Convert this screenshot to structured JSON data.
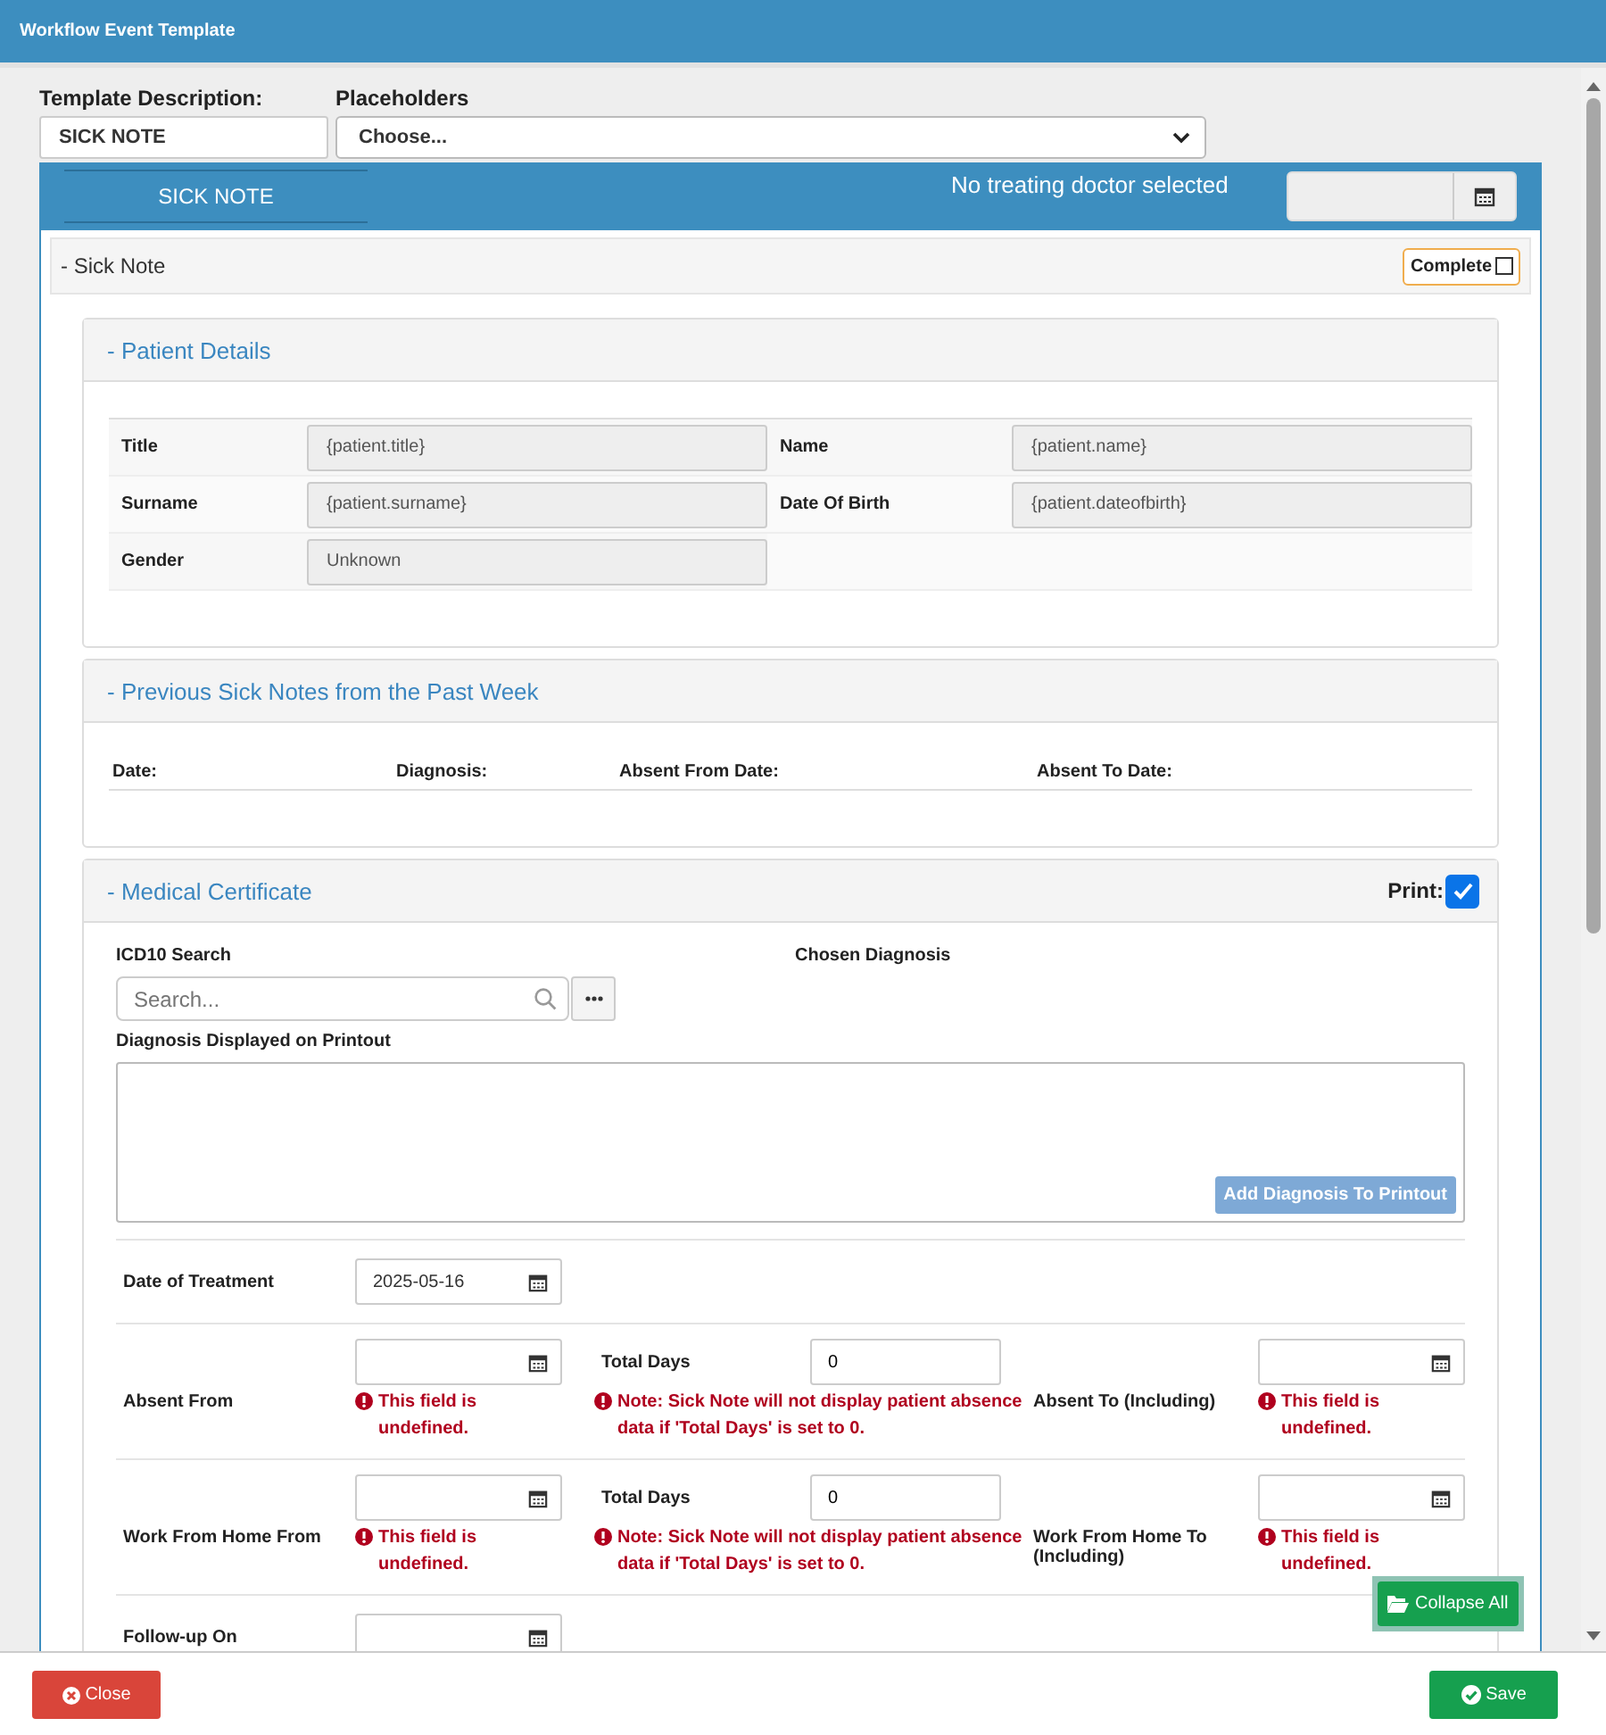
{
  "window": {
    "title": "Workflow Event Template"
  },
  "template_description": {
    "label": "Template Description:",
    "value": "SICK NOTE"
  },
  "placeholders": {
    "label": "Placeholders",
    "value": "Choose..."
  },
  "banner": {
    "tab": "SICK NOTE",
    "doctor": "No treating doctor selected"
  },
  "section": {
    "title": "- Sick Note",
    "complete": {
      "label": "Complete",
      "checked": false
    }
  },
  "patient_details": {
    "title": "- Patient Details",
    "fields": [
      {
        "label": "Title",
        "value": "{patient.title}"
      },
      {
        "label": "Name",
        "value": "{patient.name}"
      },
      {
        "label": "Surname",
        "value": "{patient.surname}"
      },
      {
        "label": "Date Of Birth",
        "value": "{patient.dateofbirth}"
      },
      {
        "label": "Gender",
        "value": "Unknown"
      }
    ]
  },
  "previous_sick_notes": {
    "title": "- Previous Sick Notes from the Past Week",
    "columns": [
      "Date:",
      "Diagnosis:",
      "Absent From Date:",
      "Absent To Date:"
    ]
  },
  "medical_certificate": {
    "title": "- Medical Certificate",
    "print": {
      "label": "Print:",
      "checked": true
    },
    "icd_label": "ICD10 Search",
    "search_placeholder": "Search...",
    "chosen_label": "Chosen Diagnosis",
    "printout_label": "Diagnosis Displayed on Printout",
    "add_button": "Add Diagnosis To Printout",
    "treatment": {
      "label": "Date of Treatment",
      "value": "2025-05-16"
    },
    "ranges": [
      {
        "label": "Absent From",
        "error": "This field is undefined.",
        "total_label": "Total Days",
        "total_value": "0",
        "note": "Note: Sick Note will not display patient absence data if 'Total Days' is set to 0.",
        "to_label": "Absent To (Including)",
        "to_error": "This field is undefined."
      },
      {
        "label": "Work From Home From",
        "error": "This field is undefined.",
        "total_label": "Total Days",
        "total_value": "0",
        "note": "Note: Sick Note will not display patient absence data if 'Total Days' is set to 0.",
        "to_label": "Work From Home To (Including)",
        "to_error": "This field is undefined."
      }
    ],
    "follow_up": {
      "label": "Follow-up On"
    }
  },
  "collapse_button": "Collapse All",
  "close_button": "Close",
  "save_button": "Save"
}
